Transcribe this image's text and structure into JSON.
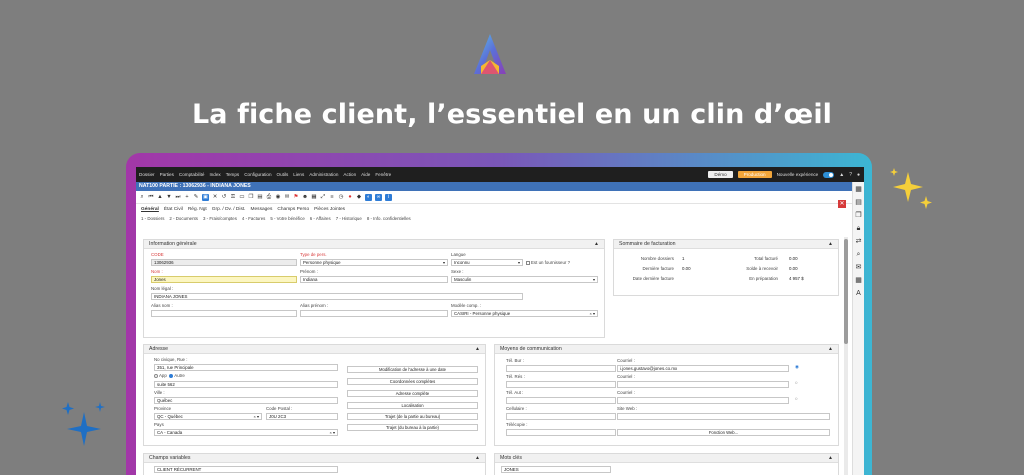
{
  "headline": "La fiche client, l’essentiel en un clin d’œil",
  "colors": {
    "background": "#7e7e7e",
    "accent_blue": "#3f72b8",
    "prod_orange": "#f2a63b"
  },
  "menu": [
    "Dossier",
    "Parties",
    "Comptabilité",
    "Index",
    "Temps",
    "Configuration",
    "Outils",
    "Liens",
    "Administration",
    "Action",
    "Aide",
    "Fenêtre"
  ],
  "top_right": {
    "demo": "Démo",
    "production": "Production",
    "new_look": "Nouvelle expérience"
  },
  "title": "NAT100   PARTIE : 13062936 - INDIANA JONES",
  "tabs": [
    "Général",
    "État Civil",
    "Rég. Ngt",
    "Grp. / Dv. / Dist.",
    "Messages",
    "Champs Perso",
    "Pièces Jointes"
  ],
  "subtabs": [
    "1 - Dossiers",
    "2 - Documents",
    "3 - Frais/comptes",
    "4 - Factures",
    "5 - Votre bénéfice",
    "6 - Affaires",
    "7 - Historique",
    "8 - Info. confidentielles"
  ],
  "info": {
    "header": "Information générale",
    "code_label": "CODE",
    "code_value": "13062936",
    "type_label": "Type de pers.",
    "type_value": "Personne physique",
    "langue_label": "Langue",
    "langue_value": "Inconnu",
    "fournisseur_label": "Est un fournisseur ?",
    "nom_label": "Nom :",
    "nom_value": "Jones",
    "prenom_label": "Prénom :",
    "prenom_value": "Indiana",
    "sexe_label": "Sexe :",
    "sexe_value": "Masculin",
    "nom_legal_label": "Nom légal :",
    "nom_legal_value": "INDIANA JONES",
    "alias_nom_label": "Alias nom :",
    "alias_prenom_label": "Alias prénom :",
    "modele_label": "Modèle comp. :",
    "modele_value": "CASIRI - Personne physique"
  },
  "summary": {
    "header": "Sommaire de facturation",
    "rows": [
      {
        "l1": "Nombre dossiers",
        "v1": "1",
        "l2": "Total facturé",
        "v2": "0.00"
      },
      {
        "l1": "Dernière facture",
        "v1": "0.00",
        "l2": "Solde à recevoir",
        "v2": "0.00"
      },
      {
        "l1": "Date dernière facture",
        "v1": "",
        "l2": "En préparation",
        "v2": "4 957 $"
      }
    ]
  },
  "adresse": {
    "header": "Adresse",
    "civique_label": "No civique, Rue :",
    "civique_value": "351, rue Principale",
    "app_label": "App",
    "autre_label": "Autre",
    "autre_value": "suite 562",
    "ville_label": "Ville :",
    "ville_value": "Québec",
    "province_label": "Province",
    "province_value": "QC - Québec",
    "postal_label": "Code Postal :",
    "postal_value": "J0U 2C3",
    "pays_label": "Pays",
    "pays_value": "CA - Canada",
    "buttons": [
      "Modification de l'adresse à une date",
      "Coordonnées complètes",
      "Adresse complète",
      "Localisation",
      "Trajet (de la partie au bureau)",
      "Trajet (du bureau à la partie)"
    ]
  },
  "moyens": {
    "header": "Moyens de communication",
    "tel_bur": "Tél. Bur :",
    "tel_res": "Tél. Rés :",
    "tel_aut": "Tél. Aut :",
    "cellulaire": "Cellulaire :",
    "telecopie": "Télécopie :",
    "courriel_label": "Courriel :",
    "courriel_value": "i.jones.gustavo@jones.co.mx",
    "courriel2": "Courriel :",
    "courriel3": "Courriel :",
    "site_web": "Site Web :",
    "fonction_web": "Fonction Web..."
  },
  "champs": {
    "header": "Champs variables",
    "value": "CLIENT RÉCURRENT"
  },
  "mots": {
    "header": "Mots clés",
    "value": "JONES"
  }
}
